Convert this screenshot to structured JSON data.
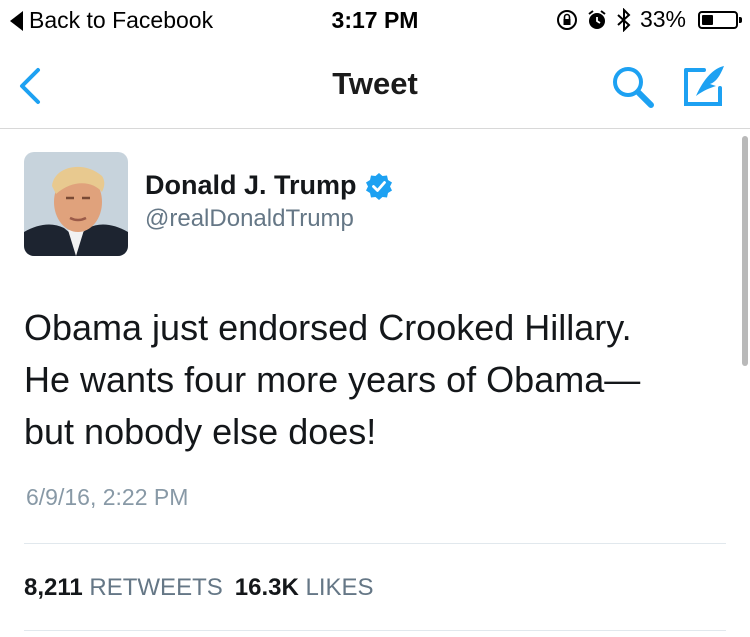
{
  "status_bar": {
    "back_label": "Back to Facebook",
    "time": "3:17 PM",
    "battery_percent": "33%",
    "battery_level": 0.33,
    "icons": [
      "rotation-lock-icon",
      "alarm-icon",
      "bluetooth-icon",
      "battery-icon"
    ]
  },
  "nav": {
    "title": "Tweet",
    "back_icon": "chevron-left-icon",
    "search_icon": "search-icon",
    "compose_icon": "compose-icon"
  },
  "tweet": {
    "author_name": "Donald J. Trump",
    "author_handle": "@realDonaldTrump",
    "verified": true,
    "text_lines": [
      "Obama just endorsed Crooked Hillary.",
      "He wants four more years of Obama—",
      "but nobody else does!"
    ],
    "timestamp": "6/9/16, 2:22 PM",
    "retweets_count": "8,211",
    "retweets_label": "RETWEETS",
    "likes_count": "16.3K",
    "likes_label": "LIKES"
  },
  "colors": {
    "accent": "#1da1f2",
    "verified": "#1da1f2",
    "secondary_text": "#657786"
  }
}
